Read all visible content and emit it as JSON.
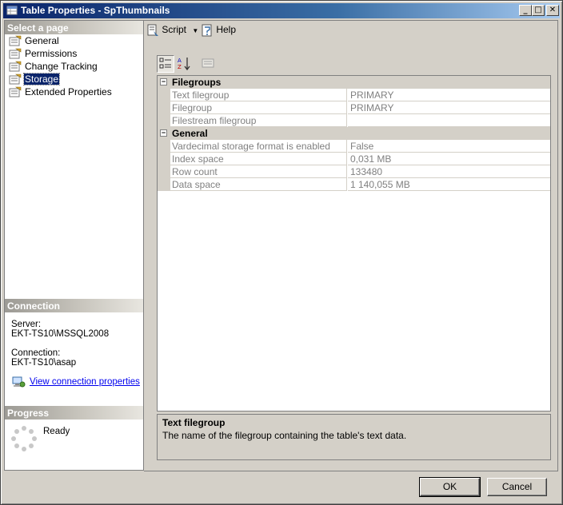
{
  "window": {
    "title": "Table Properties - SpThumbnails",
    "minimize_glyph": "_",
    "maximize_glyph": "□",
    "close_glyph": "✕"
  },
  "left": {
    "select_page_header": "Select a page",
    "pages": [
      {
        "label": "General",
        "icon": "page-properties-icon"
      },
      {
        "label": "Permissions",
        "icon": "page-properties-icon"
      },
      {
        "label": "Change Tracking",
        "icon": "page-properties-icon"
      },
      {
        "label": "Storage",
        "icon": "page-properties-icon"
      },
      {
        "label": "Extended Properties",
        "icon": "page-properties-icon"
      }
    ],
    "selected_page": "Storage",
    "connection_header": "Connection",
    "server_label": "Server:",
    "server_value": "EKT-TS10\\MSSQL2008",
    "connection_label": "Connection:",
    "connection_value": "EKT-TS10\\asap",
    "view_connection_link": "View connection properties",
    "progress_header": "Progress",
    "progress_status": "Ready"
  },
  "toolbar": {
    "script_label": "Script",
    "help_label": "Help"
  },
  "grid": {
    "categories": [
      {
        "label": "Filegroups",
        "expander": "−",
        "properties": [
          {
            "name": "Text filegroup",
            "value": "PRIMARY"
          },
          {
            "name": "Filegroup",
            "value": "PRIMARY"
          },
          {
            "name": "Filestream filegroup",
            "value": ""
          }
        ]
      },
      {
        "label": "General",
        "expander": "−",
        "properties": [
          {
            "name": "Vardecimal storage format is enabled",
            "value": "False"
          },
          {
            "name": "Index space",
            "value": "0,031 MB"
          },
          {
            "name": "Row count",
            "value": "133480"
          },
          {
            "name": "Data space",
            "value": "1 140,055 MB"
          }
        ]
      }
    ]
  },
  "description": {
    "title": "Text filegroup",
    "text": "The name of the filegroup containing the table's text data."
  },
  "buttons": {
    "ok": "OK",
    "cancel": "Cancel"
  },
  "colors": {
    "title_bar": "#0a246a",
    "selection": "#0a246a",
    "link": "#0000ee",
    "window_face": "#d4d0c8"
  }
}
